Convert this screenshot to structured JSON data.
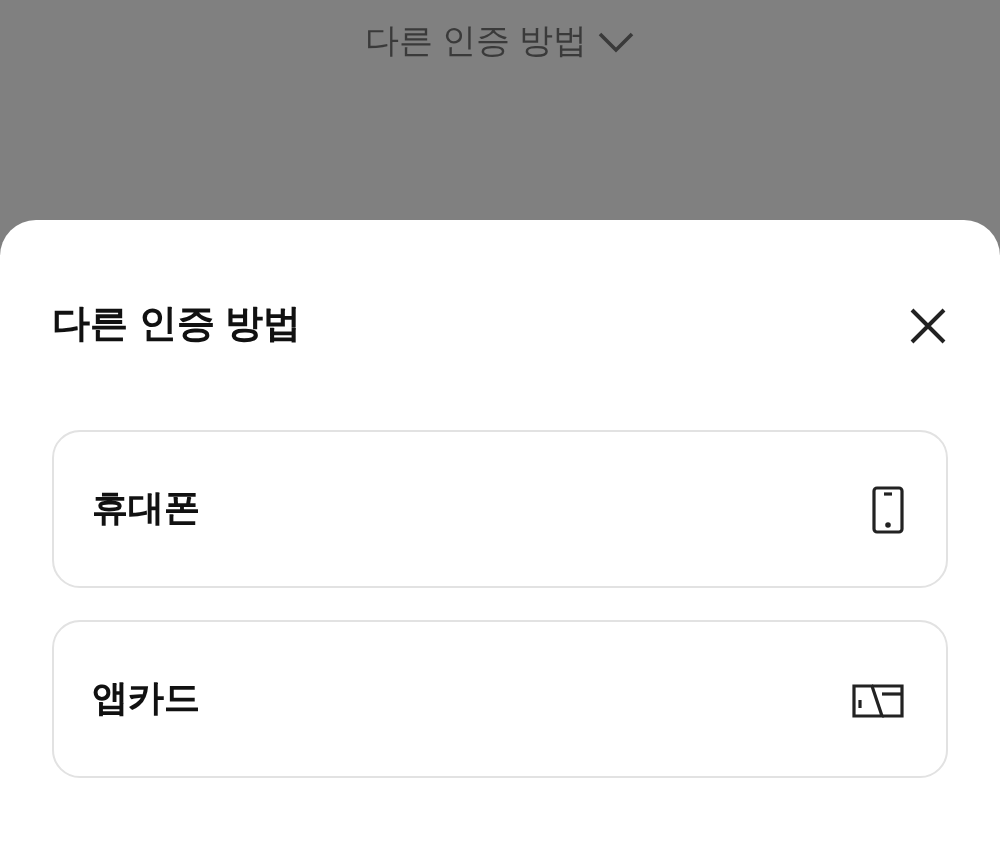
{
  "background_link": {
    "label": "다른 인증 방법"
  },
  "sheet": {
    "title": "다른 인증 방법",
    "options": [
      {
        "label": "휴대폰",
        "kind": "phone"
      },
      {
        "label": "앱카드",
        "kind": "card"
      }
    ]
  }
}
